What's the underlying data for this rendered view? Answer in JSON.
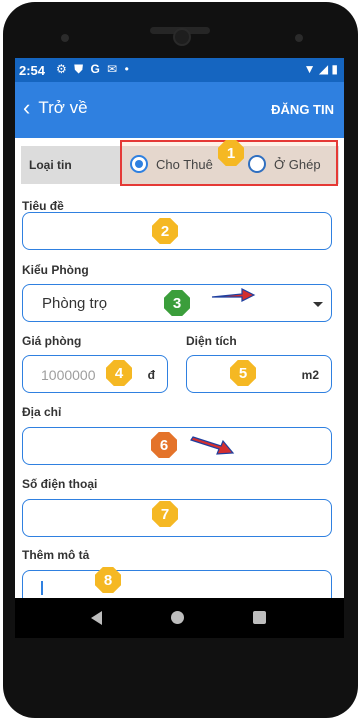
{
  "status_bar": {
    "time": "2:54",
    "icons": [
      "gear-icon",
      "shield-icon",
      "g-icon",
      "mail-icon",
      "dot-icon"
    ],
    "right_icons": [
      "wifi-icon",
      "signal-icon",
      "battery-icon"
    ]
  },
  "app_bar": {
    "back_label": "Trở về",
    "post_label": "ĐĂNG TIN"
  },
  "listing_type": {
    "label": "Loại tin",
    "options": [
      {
        "label": "Cho Thuê",
        "selected": true
      },
      {
        "label": "Ở Ghép",
        "selected": false
      }
    ]
  },
  "form": {
    "title_label": "Tiêu đề",
    "title_value": "",
    "room_type_label": "Kiểu Phòng",
    "room_type_value": "Phòng trọ",
    "price_label": "Giá phòng",
    "price_placeholder": "1000000",
    "price_unit": "đ",
    "area_label": "Diện tích",
    "area_unit": "m2",
    "address_label": "Địa chỉ",
    "phone_label": "Số điện thoại",
    "description_label": "Thêm mô tả"
  },
  "annotations": [
    "1",
    "2",
    "3",
    "4",
    "5",
    "6",
    "7",
    "8"
  ],
  "colors": {
    "primary": "#2f80e0",
    "status_bar": "#1565c0",
    "highlight_border": "#e53935",
    "badge_yellow": "#f5b823",
    "badge_green": "#3b9e3b",
    "badge_orange": "#e4732a",
    "arrow": "#d32f2f"
  }
}
